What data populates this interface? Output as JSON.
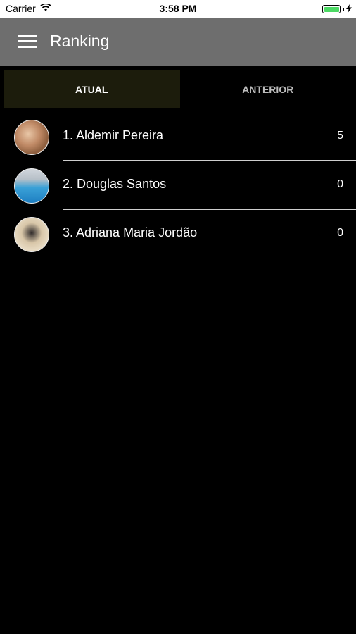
{
  "status_bar": {
    "carrier": "Carrier",
    "time": "3:58 PM"
  },
  "app_bar": {
    "title": "Ranking"
  },
  "tabs": [
    {
      "label": "ATUAL",
      "active": true
    },
    {
      "label": "ANTERIOR",
      "active": false
    }
  ],
  "ranking": [
    {
      "name": "1. Aldemir Pereira",
      "score": "5"
    },
    {
      "name": "2. Douglas Santos",
      "score": "0"
    },
    {
      "name": "3. Adriana Maria Jordão",
      "score": "0"
    }
  ],
  "colors": {
    "app_bar": "#6e6e6e",
    "active_tab": "#1c1c0c",
    "background": "#000000",
    "battery": "#4cd964"
  }
}
